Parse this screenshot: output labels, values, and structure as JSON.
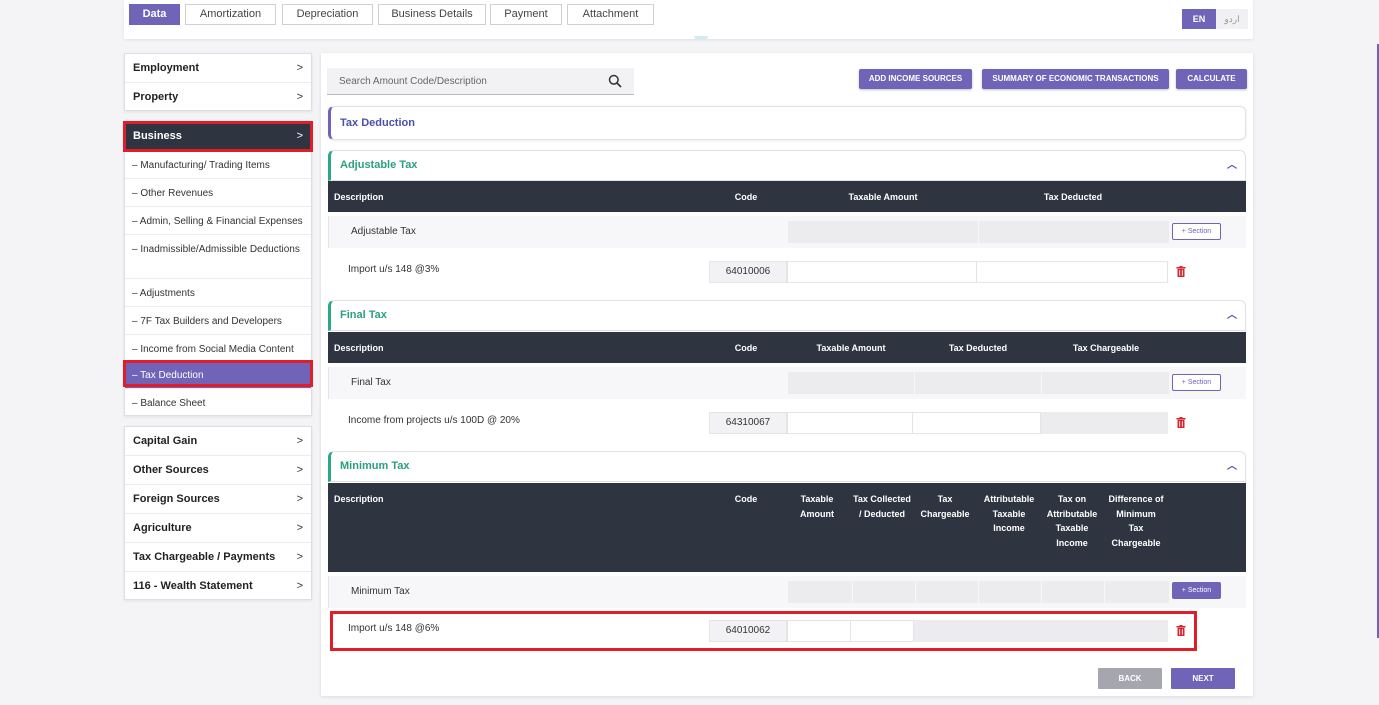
{
  "top_tabs": [
    "Data",
    "Amortization",
    "Depreciation",
    "Business Details",
    "Payment",
    "Attachment"
  ],
  "lang": {
    "en": "EN",
    "ur": "اردو"
  },
  "sidebar_top": [
    "Employment",
    "Property"
  ],
  "sidebar_business": {
    "title": "Business",
    "subitems": [
      "– Manufacturing/ Trading Items",
      "– Other Revenues",
      "– Admin, Selling & Financial Expenses",
      "– Inadmissible/Admissible Deductions",
      "– Adjustments",
      "– 7F Tax Builders and Developers",
      "– Income from Social Media Content",
      "– Tax Deduction",
      "– Balance Sheet"
    ]
  },
  "sidebar_bottom": [
    "Capital Gain",
    "Other Sources",
    "Foreign Sources",
    "Agriculture",
    "Tax Chargeable / Payments",
    "116 - Wealth Statement"
  ],
  "chevron": ">",
  "search": {
    "placeholder": "Search Amount Code/Description"
  },
  "buttons": {
    "add_income": "ADD INCOME SOURCES",
    "summary": "SUMMARY OF ECONOMIC TRANSACTIONS",
    "calculate": "CALCULATE",
    "back": "BACK",
    "next": "NEXT"
  },
  "tax_deduction_title": "Tax Deduction",
  "section_btn": "+ Section",
  "adjustable": {
    "title": "Adjustable Tax",
    "headers": [
      "Description",
      "Code",
      "Taxable Amount",
      "Tax Deducted"
    ],
    "section_label": "Adjustable Tax",
    "row": {
      "desc": "Import u/s 148 @3%",
      "code": "64010006"
    }
  },
  "final": {
    "title": "Final Tax",
    "headers": [
      "Description",
      "Code",
      "Taxable Amount",
      "Tax Deducted",
      "Tax Chargeable"
    ],
    "section_label": "Final Tax",
    "row": {
      "desc": "Income from projects u/s 100D @ 20%",
      "code": "64310067"
    }
  },
  "minimum": {
    "title": "Minimum Tax",
    "headers": [
      "Description",
      "Code",
      "Taxable Amount",
      "Tax Collected / Deducted",
      "Tax Chargeable",
      "Attributable Taxable Income",
      "Tax on Attributable Taxable Income",
      "Difference of Minimum Tax Chargeable"
    ],
    "section_label": "Minimum Tax",
    "row": {
      "desc": "Import u/s 148 @6%",
      "code": "64010062"
    }
  },
  "colors": {
    "accent": "#6f64b8",
    "dark": "#2e3540",
    "highlight": "#e01e2a",
    "green": "#2aa07f",
    "delete": "#d9232d"
  }
}
